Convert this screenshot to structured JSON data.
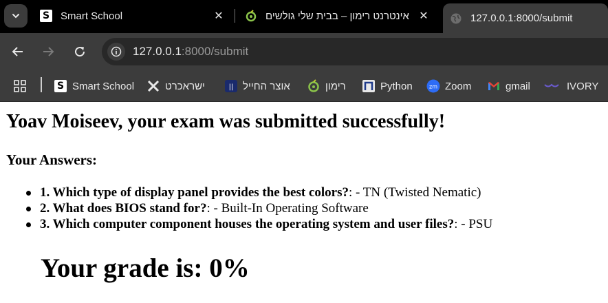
{
  "browser": {
    "tabs": [
      {
        "title": "Smart School",
        "favicon": "smart-school-logo"
      },
      {
        "title": "אינטרנט רימון – בבית שלי גולשים",
        "favicon": "rimon-logo"
      },
      {
        "title": "127.0.0.1:8000/submit",
        "favicon": "globe-icon"
      }
    ],
    "close_glyph": "✕",
    "address": {
      "host": "127.0.0.1",
      "rest": ":8000/submit"
    },
    "bookmarks": [
      {
        "label": "Smart School",
        "icon": "smart-school-logo"
      },
      {
        "label": "ישראכרט",
        "icon": "isracard-logo"
      },
      {
        "label": "אוצר החייל",
        "icon": "otsar-hahayal-logo"
      },
      {
        "label": "רימון",
        "icon": "rimon-logo"
      },
      {
        "label": "Python",
        "icon": "python-logo"
      },
      {
        "label": "Zoom",
        "icon": "zoom-logo"
      },
      {
        "label": "gmail",
        "icon": "gmail-logo"
      },
      {
        "label": "IVORY",
        "icon": "ivory-logo"
      }
    ],
    "colors": {
      "tabstrip": "#000000",
      "toolbar": "#3c3c3c",
      "omnibox": "#282828",
      "text": "#e8e8e8"
    }
  },
  "page": {
    "heading": "Yoav Moiseev, your exam was submitted successfully!",
    "answers_heading": "Your Answers:",
    "answers": [
      {
        "question": "1. Which type of display panel provides the best colors?",
        "answer": ": - TN (Twisted Nematic)"
      },
      {
        "question": "2. What does BIOS stand for?",
        "answer": ": - Built-In Operating Software"
      },
      {
        "question": "3. Which computer component houses the operating system and user files?",
        "answer": ": - PSU"
      }
    ],
    "grade": "Your grade is: 0%"
  }
}
